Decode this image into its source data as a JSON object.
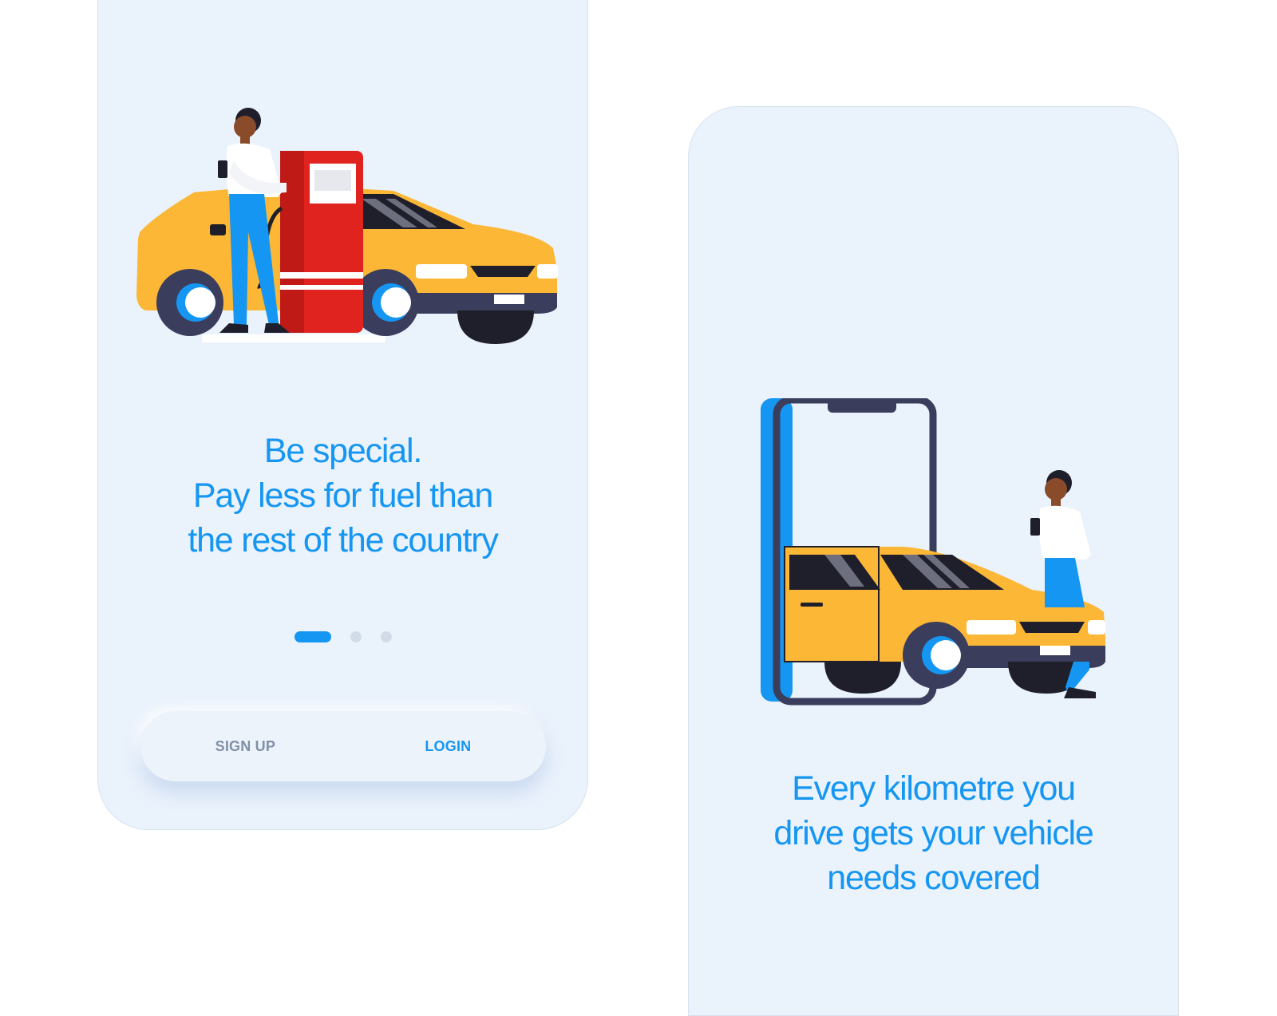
{
  "screens": [
    {
      "headline": [
        "Be special.",
        "Pay less for fuel than",
        "the rest of the country"
      ],
      "pager": {
        "total": 3,
        "active": 1
      },
      "actions": {
        "signup_label": "SIGN UP",
        "login_label": "LOGIN"
      }
    },
    {
      "headline": [
        "Every kilometre you",
        "drive gets your vehicle",
        "needs covered"
      ]
    }
  ],
  "colors": {
    "accent": "#1596f2",
    "screen_bg": "#eaf2fc",
    "car_yellow": "#fbb735",
    "pump_red": "#e0231e",
    "dark": "#3b3d5c"
  }
}
